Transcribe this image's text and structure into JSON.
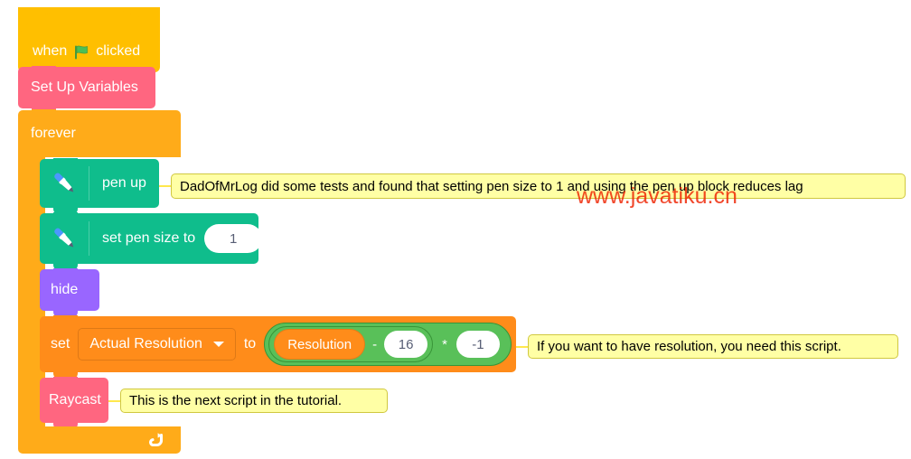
{
  "script": {
    "hat": {
      "prefix": "when",
      "icon": "green-flag-icon",
      "suffix": "clicked"
    },
    "setup_variables": {
      "label": "Set Up Variables"
    },
    "forever": {
      "label": "forever",
      "loop_icon": "loop-arrow-icon"
    },
    "pen_up": {
      "label": "pen up",
      "icon": "pen-icon"
    },
    "set_pen_size": {
      "label": "set pen size to",
      "icon": "pen-icon",
      "value": "1"
    },
    "hide": {
      "label": "hide"
    },
    "set_variable": {
      "set_label": "set",
      "variable": "Actual Resolution",
      "to_label": "to",
      "expression": {
        "multiply": {
          "left": {
            "subtract": {
              "left_variable": "Resolution",
              "operator": "-",
              "right": "16"
            }
          },
          "operator": "*",
          "right": "-1"
        }
      }
    },
    "raycast": {
      "label": "Raycast"
    }
  },
  "comments": [
    {
      "id": "comment-pen-lag",
      "text": "DadOfMrLog did some tests and found that setting pen size to 1 and using the pen up block reduces lag"
    },
    {
      "id": "comment-resolution",
      "text": "If you want to have resolution, you need this script."
    },
    {
      "id": "comment-raycast",
      "text": "This is the next script in the tutorial."
    }
  ],
  "watermark": {
    "text": "www.javatiku.cn",
    "color": "#ee2200"
  },
  "colors": {
    "events_hat": "#ffbf00",
    "custom_block": "#ff6680",
    "control": "#ffab19",
    "pen": "#0fbd8c",
    "looks": "#9966ff",
    "variables": "#ff8c1a",
    "operators": "#59c059",
    "comment_bg": "#ffffa5"
  }
}
